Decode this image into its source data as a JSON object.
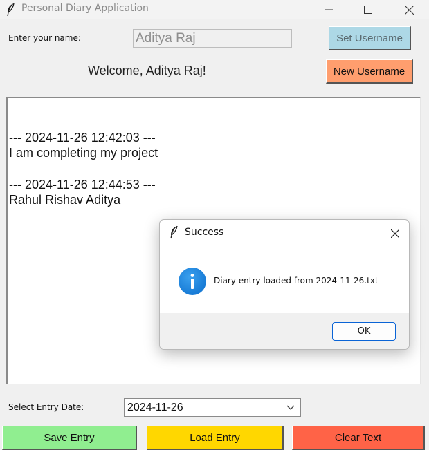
{
  "window": {
    "title": "Personal Diary Application",
    "icon": "feather-icon",
    "controls": [
      "minimize-icon",
      "maximize-icon",
      "close-icon"
    ]
  },
  "username_row": {
    "label": "Enter your name:",
    "input_value": "Aditya Raj",
    "set_button": "Set Username",
    "new_button": "New Username",
    "welcome": "Welcome, Aditya Raj!"
  },
  "text_area": {
    "lines": [
      "--- 2024-11-26 12:42:03 ---",
      "I am completing my project",
      "--- 2024-11-26 12:44:53 ---",
      "Rahul Rishav Aditya"
    ]
  },
  "date_row": {
    "label": "Select Entry Date:",
    "selected": "2024-11-26"
  },
  "buttons": {
    "save": "Save Entry",
    "load": "Load Entry",
    "clear": "Clear Text"
  },
  "dialog": {
    "title": "Success",
    "message": "Diary entry loaded from 2024-11-26.txt",
    "ok": "OK",
    "icon": "info-icon"
  },
  "colors": {
    "set_button_bg": "#add8e6",
    "new_button_bg": "#ff9e6e",
    "save_bg": "#90ee90",
    "load_bg": "#ffd700",
    "clear_bg": "#ff6347",
    "dialog_accent": "#0a64d6"
  }
}
